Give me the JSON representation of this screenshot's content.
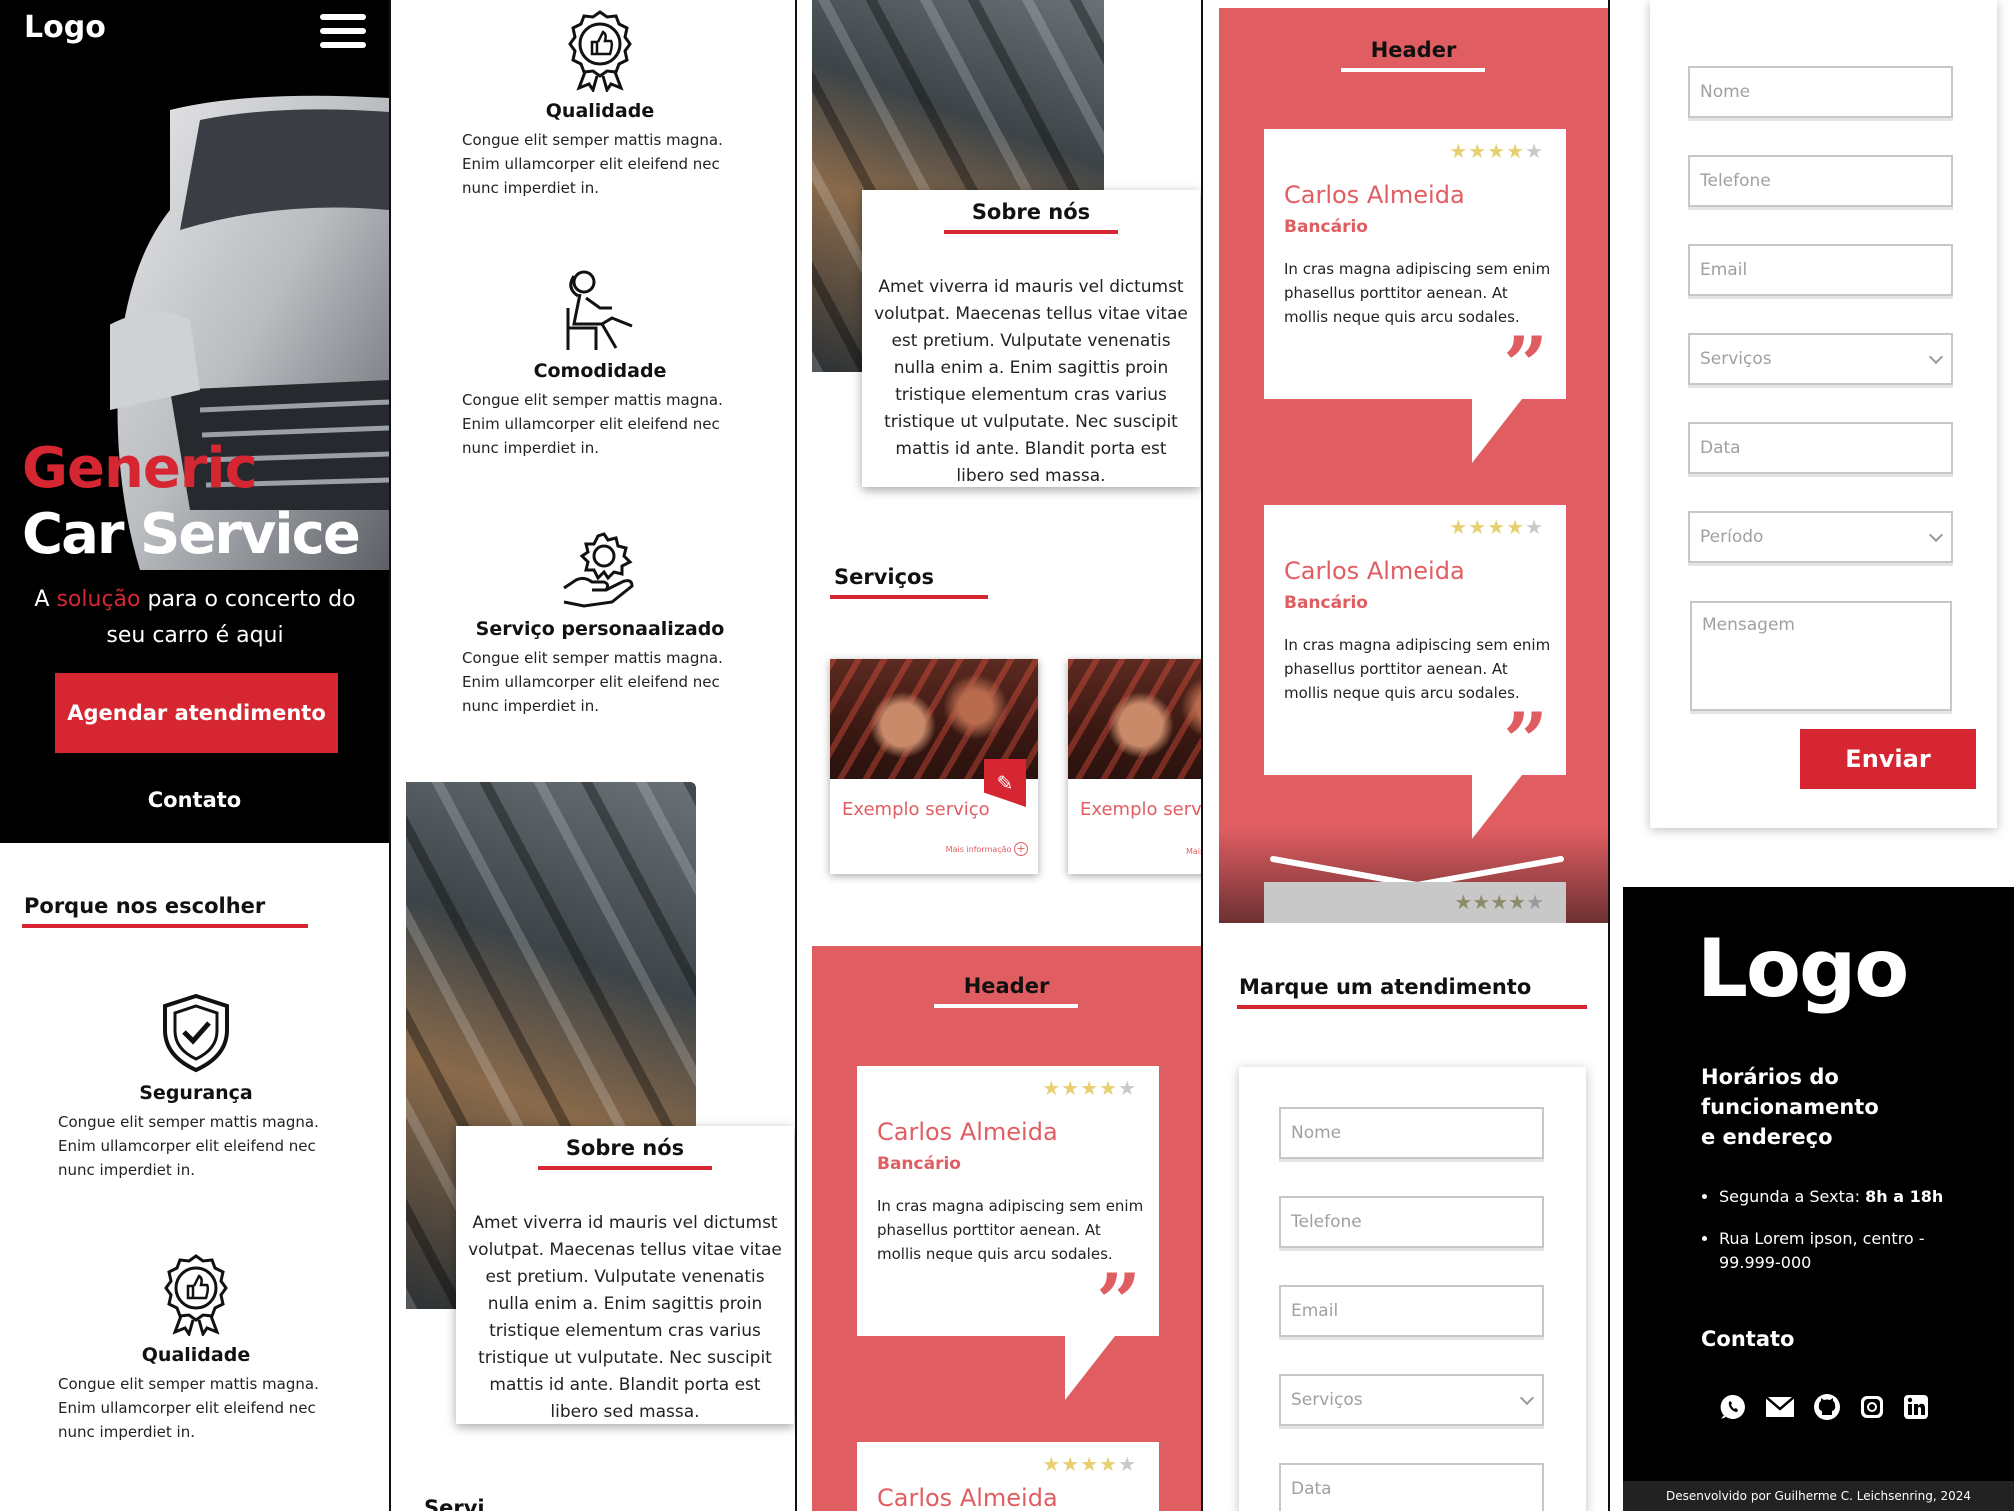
{
  "colors": {
    "accent": "#d62631",
    "testimonial_bg": "#e05d62",
    "star": "#e8cf72",
    "dark": "#000000"
  },
  "frame1": {
    "logo": "Logo",
    "menu_icon": "hamburger-icon",
    "hero_title_red": "Generic",
    "hero_title_white": "Car Service",
    "hero_sub_pre": "A ",
    "hero_sub_red": "solução",
    "hero_sub_post": " para o concerto do seu carro é aqui",
    "cta": "Agendar atendimento",
    "contact": "Contato",
    "why_title": "Porque nos escolher",
    "features": [
      {
        "icon": "shield-check-icon",
        "title": "Segurança",
        "desc": "Congue elit semper mattis magna.\n Enim ullamcorper elit eleifend nec nunc imperdiet in."
      },
      {
        "icon": "award-badge-icon",
        "title": "Qualidade",
        "desc": "Congue elit semper mattis magna.\n Enim ullamcorper elit eleifend nec nunc imperdiet in."
      }
    ]
  },
  "frame2": {
    "features": [
      {
        "icon": "award-badge-icon",
        "title": "Qualidade",
        "desc": "Congue elit semper mattis magna.\n Enim ullamcorper elit eleifend nec nunc imperdiet in."
      },
      {
        "icon": "relaxing-person-icon",
        "title": "Comodidade",
        "desc": "Congue elit semper mattis magna.\n Enim ullamcorper elit eleifend nec nunc imperdiet in."
      },
      {
        "icon": "gear-hand-icon",
        "title": "Serviço personaalizado",
        "desc": "Congue elit semper mattis magna.\n Enim ullamcorper elit eleifend nec nunc imperdiet in."
      }
    ],
    "about_title": "Sobre nós",
    "about_text": "Amet viverra id mauris vel dictumst volutpat. Maecenas tellus vitae vitae est pretium. Vulputate venenatis nulla enim a. Enim sagittis proin tristique elementum cras varius tristique ut vulputate. Nec suscipit mattis id ante. Blandit porta est libero sed massa.",
    "next_section_partial": "Servi"
  },
  "frame3": {
    "about_title": "Sobre nós",
    "about_text": "Amet viverra id mauris vel dictumst volutpat. Maecenas tellus vitae vitae est pretium. Vulputate venenatis nulla enim a. Enim sagittis proin tristique elementum cras varius tristique ut vulputate. Nec suscipit mattis id ante. Blandit porta est libero sed massa.",
    "services_title": "Serviços",
    "services": [
      {
        "title": "Exemplo serviço",
        "more": "Mais informação"
      },
      {
        "title": "Exemplo servi",
        "more": "Mais"
      }
    ],
    "testimonials_header": "Header",
    "testimonial": {
      "name": "Carlos Almeida",
      "role": "Bancário",
      "text": "In cras magna adipiscing sem enim phasellus porttitor aenean. At mollis neque quis arcu sodales.",
      "stars_on": 4,
      "stars_total": 5
    }
  },
  "frame4": {
    "testimonials_header": "Header",
    "testimonials": [
      {
        "name": "Carlos Almeida",
        "role": "Bancário",
        "text": "In cras magna adipiscing sem enim phasellus porttitor aenean. At mollis neque quis arcu sodales.",
        "stars_on": 4,
        "stars_total": 5
      },
      {
        "name": "Carlos Almeida",
        "role": "Bancário",
        "text": "In cras magna adipiscing sem enim phasellus porttitor aenean. At mollis neque quis arcu sodales.",
        "stars_on": 4,
        "stars_total": 5
      }
    ],
    "booking_title": "Marque um atendimento",
    "form": {
      "name": "Nome",
      "phone": "Telefone",
      "email": "Email",
      "services": "Serviços",
      "date": "Data"
    }
  },
  "frame5": {
    "form": {
      "name": "Nome",
      "phone": "Telefone",
      "email": "Email",
      "services": "Serviços",
      "date": "Data",
      "period": "Período",
      "message": "Mensagem",
      "submit": "Enviar"
    },
    "footer_logo": "Logo",
    "hours_title": "Horários do funcionamento\n e endereço",
    "hours_label": "Segunda a Sexta: ",
    "hours_value": "8h a 18h",
    "address": "Rua Lorem ipson, centro - 99.999-000",
    "contact": "Contato",
    "social": [
      "whatsapp-icon",
      "mail-icon",
      "github-icon",
      "instagram-icon",
      "linkedin-icon"
    ],
    "credit": "Desenvolvido por Guilherme C. Leichsenring, 2024"
  }
}
